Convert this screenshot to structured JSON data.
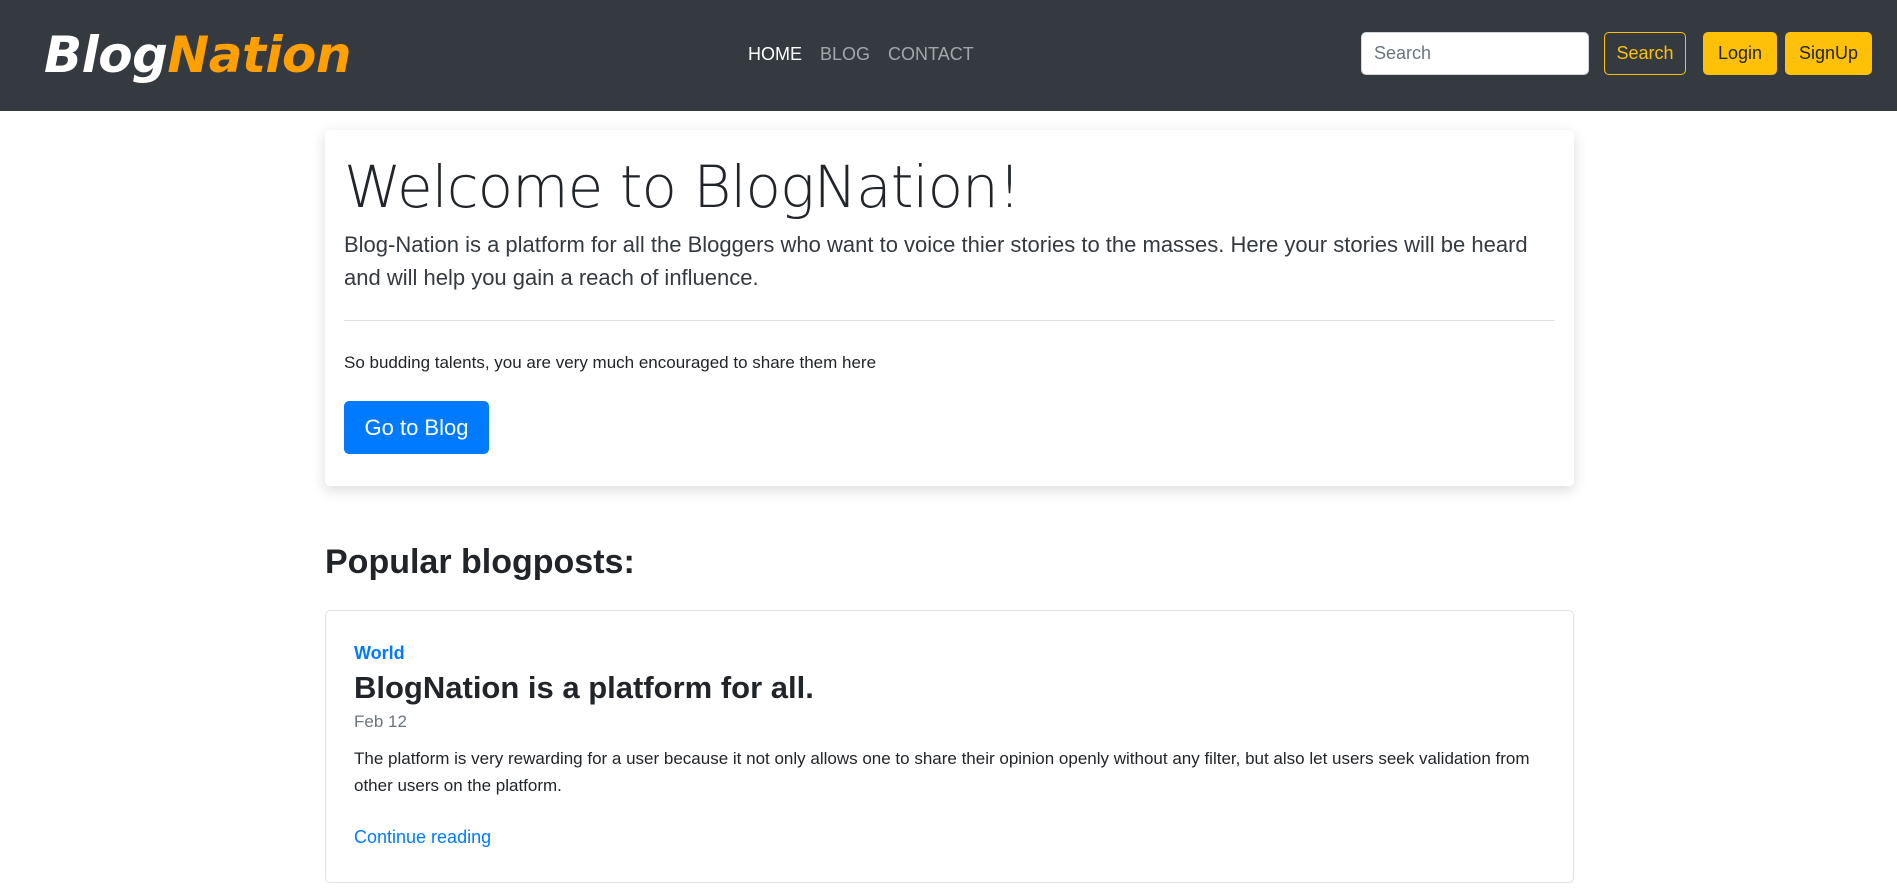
{
  "navbar": {
    "brand_part1": "Blog",
    "brand_part2": "Nation",
    "links": [
      {
        "label": "HOME",
        "active": true
      },
      {
        "label": "BLOG",
        "active": false
      },
      {
        "label": "CONTACT",
        "active": false
      }
    ],
    "search_placeholder": "Search",
    "search_button": "Search",
    "login_button": "Login",
    "signup_button": "SignUp"
  },
  "hero": {
    "title": "Welcome to BlogNation!",
    "lead": "Blog-Nation is a platform for all the Bloggers who want to voice thier stories to the masses. Here your stories will be heard and will help you gain a reach of influence.",
    "subtext": "So budding talents, you are very much encouraged to share them here",
    "button": "Go to Blog"
  },
  "popular": {
    "heading": "Popular blogposts:",
    "posts": [
      {
        "category": "World",
        "title": "BlogNation is a platform for all.",
        "date": "Feb 12",
        "description": "The platform is very rewarding for a user because it not only allows one to share their opinion openly without any filter, but also let users seek validation from other users on the platform.",
        "link": "Continue reading"
      }
    ]
  },
  "colors": {
    "navbar_bg": "#343a40",
    "brand_accent": "#ff9f00",
    "warning": "#ffc107",
    "primary": "#007bff"
  }
}
